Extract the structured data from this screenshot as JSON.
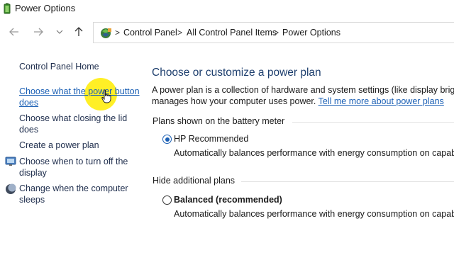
{
  "window": {
    "title": "Power Options",
    "icon": "battery-icon"
  },
  "navigation": {
    "back_icon": "arrow-left-icon",
    "forward_icon": "arrow-right-icon",
    "recent_icon": "chevron-down-icon",
    "up_icon": "arrow-up-icon"
  },
  "breadcrumb": {
    "icon": "control-panel-icon",
    "items": [
      "Control Panel",
      "All Control Panel Items",
      "Power Options"
    ],
    "separator": ">"
  },
  "sidebar": {
    "home": "Control Panel Home",
    "links": [
      {
        "line1": "Choose what the power button",
        "line2": "does",
        "icon": ""
      },
      {
        "line1": "Choose what closing the lid",
        "line2": "does",
        "icon": ""
      },
      {
        "line1": "Create a power plan",
        "line2": "",
        "icon": ""
      },
      {
        "line1": "Choose when to turn off the",
        "line2": "display",
        "icon": "monitor-icon"
      },
      {
        "line1": "Change when the computer",
        "line2": "sleeps",
        "icon": "moon-icon"
      }
    ]
  },
  "main": {
    "heading": "Choose or customize a power plan",
    "description_line1": "A power plan is a collection of hardware and system settings (like display brightness,",
    "description_line2": "manages how your computer uses power.",
    "description_link": "Tell me more about power plans",
    "battery_group_label": "Plans shown on the battery meter",
    "hidden_group_label": "Hide additional plans",
    "plans": [
      {
        "name": "HP Recommended",
        "selected": true,
        "description": "Automatically balances performance with energy consumption on capable hard"
      },
      {
        "name": "Balanced (recommended)",
        "selected": false,
        "description": "Automatically balances performance with energy consumption on capable hard"
      }
    ]
  },
  "colors": {
    "link": "#1a5fb4",
    "heading": "#1e3f6e",
    "highlight": "#ffec00"
  }
}
